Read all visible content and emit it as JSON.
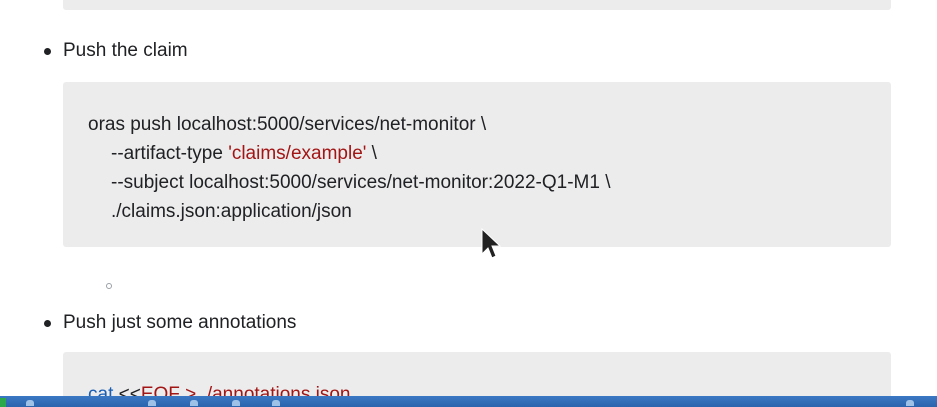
{
  "sections": {
    "claim": {
      "bullet": "Push the claim",
      "code": {
        "line1": "oras push localhost:5000/services/net-monitor \\",
        "line2_prefix": "--artifact-type ",
        "line2_string": "'claims/example'",
        "line2_suffix": " \\",
        "line3": "--subject localhost:5000/services/net-monitor:2022-Q1-M1 \\",
        "line4": "./claims.json:application/json"
      }
    },
    "annotations": {
      "bullet": "Push just some annotations",
      "code": {
        "keyword": "cat",
        "heredoc": " <<",
        "heredoc_string": "EOF > ./annotations.json"
      }
    }
  },
  "colors": {
    "code_background": "#ececec",
    "string": "#a31515",
    "keyword": "#1a5fb4",
    "taskbar": "#2a64ad"
  },
  "icons": [
    "mouse-pointer-icon",
    "hollow-bullet-icon"
  ]
}
